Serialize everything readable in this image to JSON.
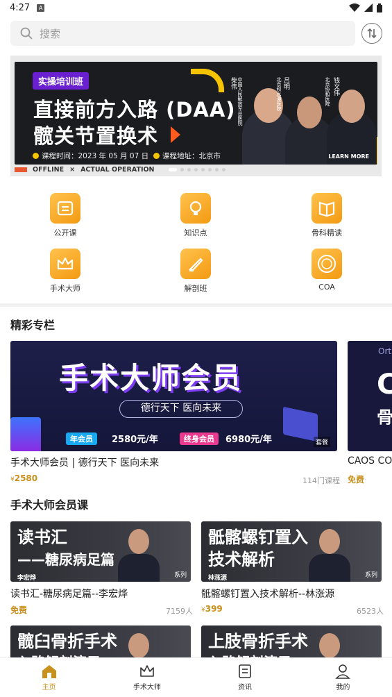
{
  "status_bar": {
    "time": "4:27",
    "notification_icon": "a-icon",
    "wifi_icon": "wifi-icon",
    "signal_icon": "signal-icon",
    "battery_icon": "battery-icon"
  },
  "search": {
    "placeholder": "搜索",
    "sort_icon": "sort-icon"
  },
  "banner": {
    "tag": "实操培训班",
    "title_line1": "直接前方入路 (DAA)",
    "title_line2": "髋关节置换术",
    "time_text": "课程时间：2023 年 05 月 07 日",
    "location_text": "课程地址：北京市",
    "doctors": [
      {
        "name": "柴伟",
        "affiliation": "中国人民解放军总医院"
      },
      {
        "name": "吕明",
        "affiliation": "北京积水潭医院"
      },
      {
        "name": "钱文伟",
        "affiliation": "北京协和医院"
      }
    ],
    "learn_more": "LEARN MORE",
    "footer_offline": "OFFLINE",
    "footer_x": "×",
    "footer_actual": "ACTUAL OPERATION",
    "accent_color": "#f5c400"
  },
  "grid": [
    {
      "label": "公开课",
      "icon": "open-class-icon"
    },
    {
      "label": "知识点",
      "icon": "lightbulb-icon"
    },
    {
      "label": "骨科精读",
      "icon": "book-icon"
    },
    {
      "label": "手术大师",
      "icon": "crown-icon"
    },
    {
      "label": "解剖班",
      "icon": "scalpel-icon"
    },
    {
      "label": "COA",
      "icon": "coa-logo-icon"
    }
  ],
  "featured": {
    "title": "精彩专栏",
    "card1": {
      "big_title": "手术大师会员",
      "slogan": "德行天下 医向未来",
      "year_tag": "年会员",
      "year_price": "2580元/年",
      "life_tag": "终身会员",
      "life_price": "6980元/年",
      "badge": "套餐",
      "caption": "手术大师会员 | 德行天下 医向未来",
      "price_symbol": "¥",
      "price": "2580",
      "count": "114门课程"
    },
    "card2": {
      "top_text": "Ort",
      "big_letter": "C",
      "small_text": "骨",
      "caption": "CAOS CO",
      "price": "免费"
    }
  },
  "member_courses": {
    "title": "手术大师会员课",
    "items": [
      {
        "thumb_line1": "读书汇",
        "thumb_line2": "——糖尿病足篇",
        "person": "李宏烨",
        "tag": "系列",
        "caption": "读书汇-糖尿病足篇--李宏烨",
        "price": "免费",
        "count": "7159人"
      },
      {
        "thumb_line1": "骶髂螺钉置入",
        "thumb_line2": "技术解析",
        "person": "林涨源",
        "tag": "系列",
        "caption": "骶髂螺钉置入技术解析--林涨源",
        "price_symbol": "¥",
        "price": "399",
        "count": "6523人"
      },
      {
        "thumb_line1": "髋臼骨折手术",
        "thumb_line2": "入路解剖演示"
      },
      {
        "thumb_line1": "上肢骨折手术",
        "thumb_line2": "入路解剖演示"
      }
    ]
  },
  "bottom_nav": [
    {
      "label": "主页",
      "icon": "home-icon",
      "active": true
    },
    {
      "label": "手术大师",
      "icon": "crown-icon",
      "active": false
    },
    {
      "label": "资讯",
      "icon": "news-icon",
      "active": false
    },
    {
      "label": "我的",
      "icon": "profile-icon",
      "active": false
    }
  ],
  "colors": {
    "gold": "#c8901c",
    "icon_orange": "#f39a12"
  }
}
